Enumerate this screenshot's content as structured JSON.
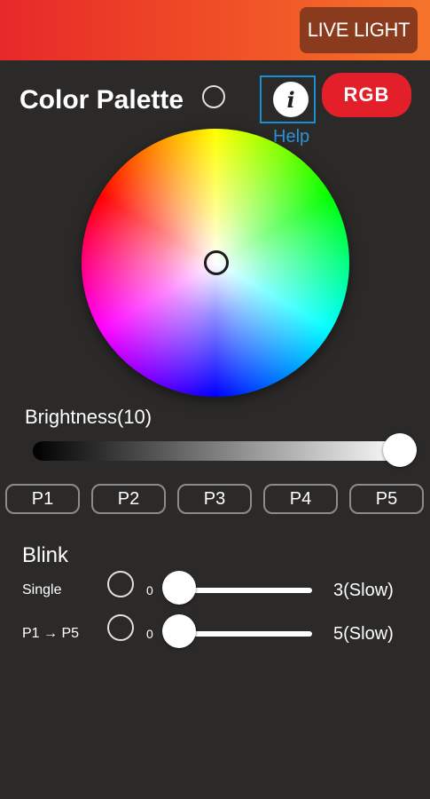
{
  "header": {
    "live_light_label": "LIVE LIGHT"
  },
  "palette": {
    "title": "Color Palette",
    "help_label": "Help",
    "info_glyph": "i",
    "rgb_label": "RGB"
  },
  "brightness": {
    "label": "Brightness(10)",
    "value": 10
  },
  "presets": [
    "P1",
    "P2",
    "P3",
    "P4",
    "P5"
  ],
  "blink": {
    "title": "Blink",
    "rows": [
      {
        "label": "Single",
        "min": "0",
        "max_label": "3(Slow)",
        "value": 0
      },
      {
        "label": "P1 → P5",
        "min": "0",
        "max_label": "5(Slow)",
        "value": 0
      }
    ]
  },
  "colors": {
    "header_start": "#e8282a",
    "header_end": "#f5742a",
    "live_button": "#8a3a1d",
    "rgb_button": "#e31f2a",
    "help_blue": "#2b93d8",
    "background": "#2b2a29"
  }
}
